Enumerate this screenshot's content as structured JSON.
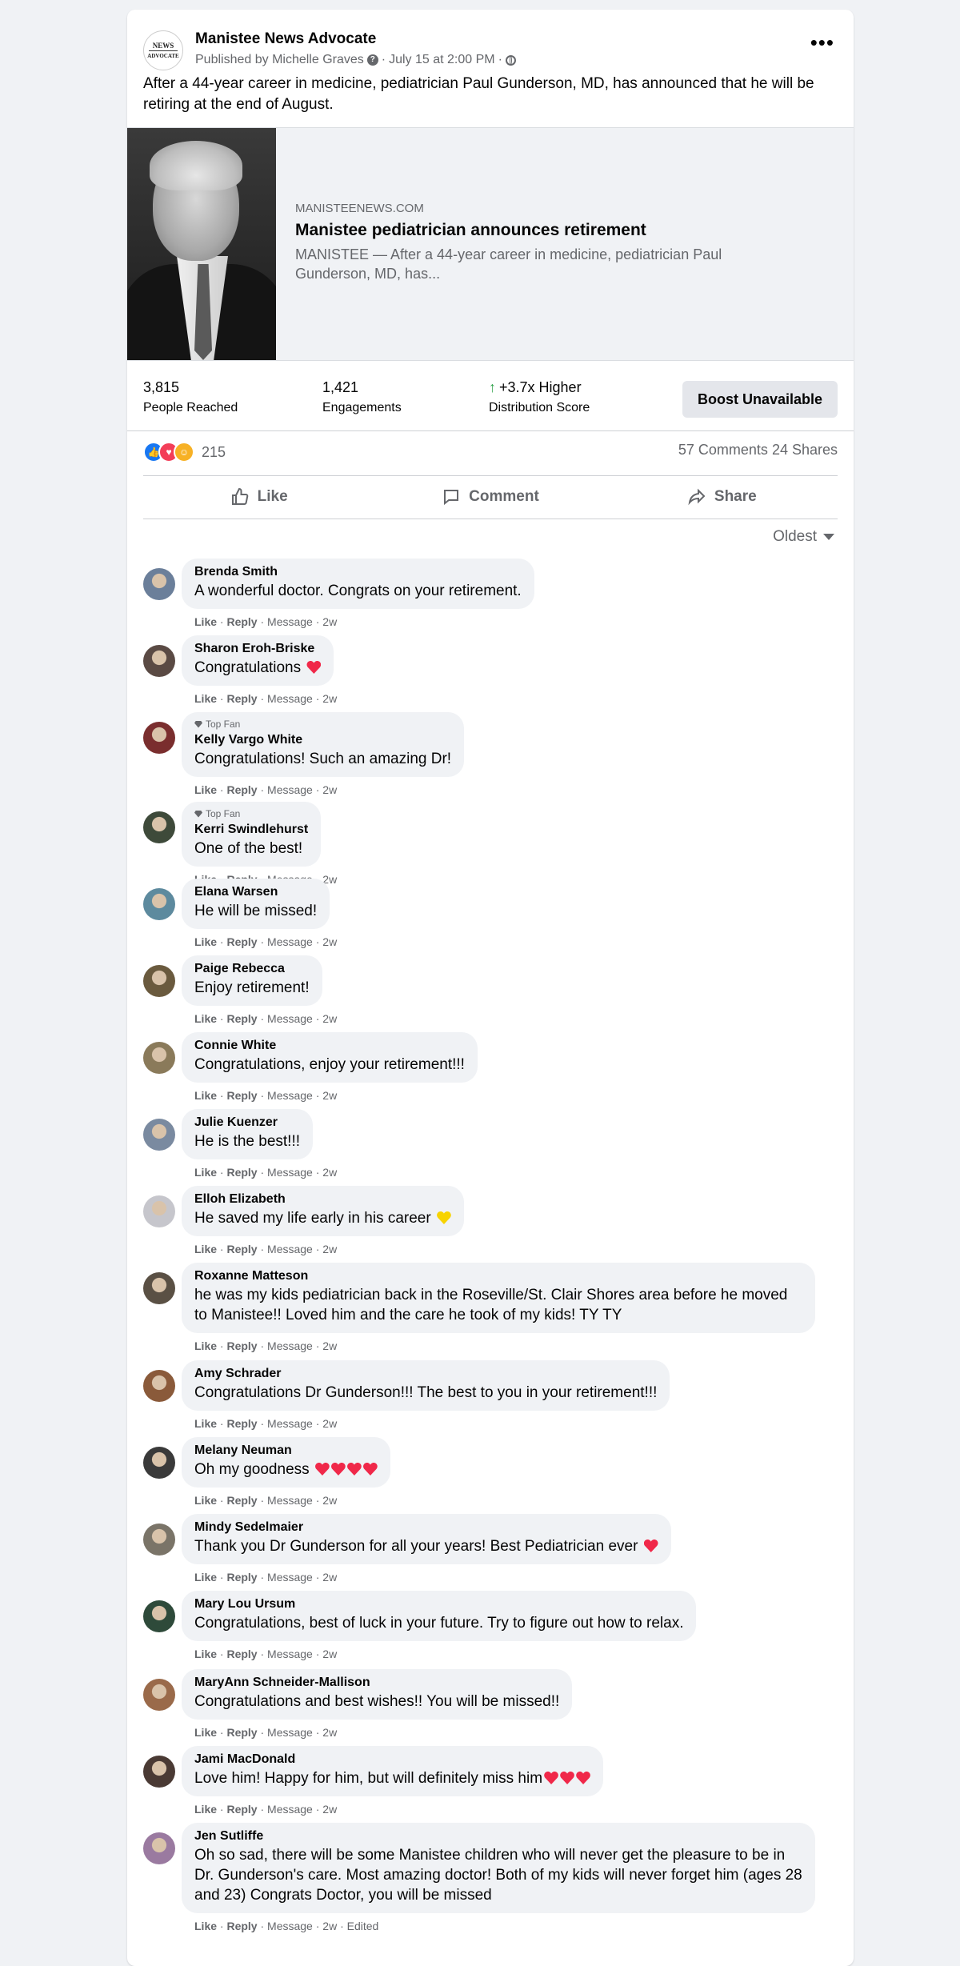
{
  "post": {
    "page_name": "Manistee News Advocate",
    "avatar_text_1": "NEWS",
    "avatar_text_2": "ADVOCATE",
    "published_by": "Published by Michelle Graves",
    "date": "July 15 at 2:00 PM",
    "text": "After a 44-year career in medicine, pediatrician Paul Gunderson, MD, has announced that he will be retiring at the end of August."
  },
  "link": {
    "domain": "MANISTEENEWS.COM",
    "title": "Manistee pediatrician announces retirement",
    "description": "MANISTEE — After a 44-year career in medicine, pediatrician Paul Gunderson, MD, has..."
  },
  "stats": {
    "people_reached": "3,815",
    "people_reached_label": "People Reached",
    "engagements": "1,421",
    "engagements_label": "Engagements",
    "distribution": "+3.7x Higher",
    "distribution_label": "Distribution Score",
    "boost_label": "Boost Unavailable"
  },
  "reactions": {
    "count": "215",
    "comments": "57 Comments",
    "shares": "24 Shares"
  },
  "actions": {
    "like": "Like",
    "comment": "Comment",
    "share": "Share"
  },
  "sort_label": "Oldest",
  "comment_actions": {
    "like": "Like",
    "reply": "Reply"
  },
  "comments": [
    {
      "name": "Brenda Smith",
      "text": "A wonderful doctor. Congrats on your retirement.",
      "meta": "· Message · 2w",
      "avatar_color": "#6b7f9a"
    },
    {
      "name": "Sharon Eroh-Briske",
      "text": "Congratulations ",
      "emoji": "heart",
      "meta": "· Message · 2w",
      "avatar_color": "#5a4a44"
    },
    {
      "name": "Kelly Vargo White",
      "badge": "Top Fan",
      "text": "Congratulations! Such an amazing Dr!",
      "meta": "· Message · 2w",
      "avatar_color": "#7a2e2e"
    },
    {
      "name": "Kerri Swindlehurst",
      "badge": "Top Fan",
      "text": "One of the best!",
      "meta": "· Message · 2w",
      "avatar_color": "#3e4a3a"
    },
    {
      "name": "Elana Warsen",
      "text": "He will be missed!",
      "meta": "· Message · 2w",
      "avatar_color": "#5d8a9e"
    },
    {
      "name": "Paige Rebecca",
      "text": "Enjoy retirement!",
      "meta": "· Message · 2w",
      "avatar_color": "#6a5a3e"
    },
    {
      "name": "Connie White",
      "text": "Congratulations, enjoy your retirement!!!",
      "meta": "· Message · 2w",
      "avatar_color": "#8a7a5a"
    },
    {
      "name": "Julie Kuenzer",
      "text": "He is the best!!!",
      "meta": "· Message · 2w",
      "avatar_color": "#7a8aa0"
    },
    {
      "name": "Elloh Elizabeth",
      "text": "He saved my life early in his career ",
      "emoji": "yellow-heart",
      "meta": "· Message · 2w",
      "avatar_color": "#c6c6cc"
    },
    {
      "name": "Roxanne Matteson",
      "text": "he was my kids pediatrician back in the Roseville/St. Clair Shores area before he moved to Manistee!! Loved him and the care he took of my kids! TY TY",
      "meta": "· Message · 2w",
      "avatar_color": "#5a5044"
    },
    {
      "name": "Amy Schrader",
      "text": "Congratulations Dr Gunderson!!! The best to you in your retirement!!!",
      "meta": "· Message · 2w",
      "avatar_color": "#8a5a3a"
    },
    {
      "name": "Melany Neuman",
      "text": "Oh my goodness ",
      "emoji": "heart4",
      "meta": "· Message · 2w",
      "avatar_color": "#3a3a3a"
    },
    {
      "name": "Mindy Sedelmaier",
      "text": "Thank you Dr Gunderson for all your years! Best Pediatrician ever ",
      "emoji": "heart",
      "meta": "· Message · 2w",
      "avatar_color": "#7a7468"
    },
    {
      "name": "Mary Lou Ursum",
      "text": "Congratulations, best of luck in your future. Try to figure out how to relax.",
      "meta": "· Message · 2w",
      "avatar_color": "#2e4a3a"
    },
    {
      "name": "MaryAnn Schneider-Mallison",
      "text": "Congratulations and best wishes!! You will be missed!!",
      "meta": "· Message · 2w",
      "avatar_color": "#9a6a4a"
    },
    {
      "name": "Jami MacDonald",
      "text": "Love him! Happy for him, but will definitely miss him",
      "emoji": "heart3",
      "meta": "· Message · 2w",
      "avatar_color": "#4a3a34"
    },
    {
      "name": "Jen Sutliffe",
      "text": "Oh so sad, there will be some Manistee children who will never get the pleasure to be in Dr. Gunderson's care. Most amazing doctor! Both of my kids will never forget him (ages 28 and 23) Congrats Doctor, you will be missed",
      "meta": "· Message · 2w · Edited",
      "avatar_color": "#9a7aa0"
    }
  ]
}
